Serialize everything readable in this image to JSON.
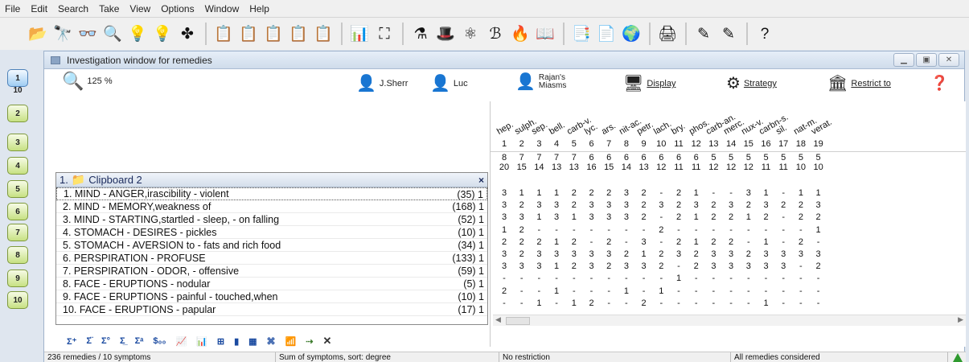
{
  "menubar": [
    "File",
    "Edit",
    "Search",
    "Take",
    "View",
    "Options",
    "Window",
    "Help"
  ],
  "toolbar_icons": [
    "open-icon",
    "binoculars-icon",
    "glasses-icon",
    "magnify-icon",
    "lightbulb-icon",
    "lightbulb-plus-icon",
    "repertory-icon",
    "clipboard-icon",
    "clipboard-1-icon",
    "clipboard-2-icon",
    "clipboard-3-icon",
    "clipboard-4-icon",
    "chart-icon",
    "hierarchy-icon",
    "flask-icon",
    "hat-icon",
    "orbit-icon",
    "ms-icon",
    "flame-icon",
    "book-icon",
    "compare-icon",
    "report-icon",
    "globe-icon",
    "printer-icon",
    "pencil-icon",
    "pencil2-icon",
    "help-icon"
  ],
  "left_tabs": [
    "1",
    "10",
    "2",
    "3",
    "4",
    "5",
    "6",
    "7",
    "8",
    "9",
    "10"
  ],
  "window": {
    "title": "Investigation window for remedies",
    "zoom": "125 %",
    "btn_sherr": "J.Sherr",
    "btn_luc": "Luc",
    "btn_rajan": "Rajan's Miasms",
    "btn_display": "Display",
    "btn_strategy": "Strategy",
    "btn_restrict": "Restrict to"
  },
  "clipboard": {
    "header": "1.",
    "name": "Clipboard 2",
    "close": "×"
  },
  "symptoms": [
    {
      "label": "1. MIND - ANGER,irascibility - violent",
      "count": "(35) 1"
    },
    {
      "label": "2. MIND - MEMORY,weakness of",
      "count": "(168) 1"
    },
    {
      "label": "3. MIND - STARTING,startled - sleep, - on falling",
      "count": "(52) 1"
    },
    {
      "label": "4. STOMACH - DESIRES - pickles",
      "count": "(10) 1"
    },
    {
      "label": "5. STOMACH - AVERSION to - fats and rich food",
      "count": "(34) 1"
    },
    {
      "label": "6. PERSPIRATION - PROFUSE",
      "count": "(133) 1"
    },
    {
      "label": "7. PERSPIRATION - ODOR, - offensive",
      "count": "(59) 1"
    },
    {
      "label": "8. FACE - ERUPTIONS - nodular",
      "count": "(5) 1"
    },
    {
      "label": "9. FACE - ERUPTIONS - painful - touched,when",
      "count": "(10) 1"
    },
    {
      "label": "10. FACE - ERUPTIONS - papular",
      "count": "(17) 1"
    }
  ],
  "remedies": [
    "hep.",
    "sulph.",
    "sep.",
    "bell.",
    "carb-v.",
    "lyc.",
    "ars.",
    "nit-ac.",
    "petr.",
    "lach.",
    "bry.",
    "phos.",
    "carb-an.",
    "merc.",
    "nux-v.",
    "carbn-s.",
    "sil.",
    "nat-m.",
    "verat."
  ],
  "rank": [
    "1",
    "2",
    "3",
    "4",
    "5",
    "6",
    "7",
    "8",
    "9",
    "10",
    "11",
    "12",
    "13",
    "14",
    "15",
    "16",
    "17",
    "18",
    "19"
  ],
  "counts": [
    "8",
    "7",
    "7",
    "7",
    "7",
    "6",
    "6",
    "6",
    "6",
    "6",
    "6",
    "6",
    "5",
    "5",
    "5",
    "5",
    "5",
    "5",
    "5"
  ],
  "sums": [
    "20",
    "15",
    "14",
    "13",
    "13",
    "16",
    "15",
    "14",
    "13",
    "12",
    "11",
    "11",
    "12",
    "12",
    "12",
    "11",
    "11",
    "10",
    "10"
  ],
  "grades": [
    [
      "3",
      "1",
      "1",
      "1",
      "2",
      "2",
      "2",
      "3",
      "2",
      "-",
      "2",
      "1",
      "-",
      "-",
      "3",
      "1",
      "-",
      "1",
      "1"
    ],
    [
      "3",
      "2",
      "3",
      "3",
      "2",
      "3",
      "3",
      "3",
      "2",
      "3",
      "2",
      "3",
      "2",
      "3",
      "2",
      "3",
      "2",
      "2",
      "3"
    ],
    [
      "3",
      "3",
      "1",
      "3",
      "1",
      "3",
      "3",
      "3",
      "2",
      "-",
      "2",
      "1",
      "2",
      "2",
      "1",
      "2",
      "-",
      "2",
      "2"
    ],
    [
      "1",
      "2",
      "-",
      "-",
      "-",
      "-",
      "-",
      "-",
      "-",
      "2",
      "-",
      "-",
      "-",
      "-",
      "-",
      "-",
      "-",
      "-",
      "1"
    ],
    [
      "2",
      "2",
      "2",
      "1",
      "2",
      "-",
      "2",
      "-",
      "3",
      "-",
      "2",
      "1",
      "2",
      "2",
      "-",
      "1",
      "-",
      "2",
      "-"
    ],
    [
      "3",
      "2",
      "3",
      "3",
      "3",
      "3",
      "3",
      "2",
      "1",
      "2",
      "3",
      "2",
      "3",
      "3",
      "2",
      "3",
      "3",
      "3",
      "3"
    ],
    [
      "3",
      "3",
      "3",
      "1",
      "2",
      "3",
      "2",
      "3",
      "3",
      "2",
      "-",
      "2",
      "3",
      "3",
      "3",
      "3",
      "3",
      "-",
      "2"
    ],
    [
      "-",
      "-",
      "-",
      "-",
      "-",
      "-",
      "-",
      "-",
      "-",
      "-",
      "1",
      "-",
      "-",
      "-",
      "-",
      "-",
      "-",
      "-",
      "-"
    ],
    [
      "2",
      "-",
      "-",
      "1",
      "-",
      "-",
      "-",
      "1",
      "-",
      "1",
      "-",
      "-",
      "-",
      "-",
      "-",
      "-",
      "-",
      "-",
      "-"
    ],
    [
      "-",
      "-",
      "1",
      "-",
      "1",
      "2",
      "-",
      "-",
      "2",
      "-",
      "-",
      "-",
      "-",
      "-",
      "-",
      "1",
      "-",
      "-",
      "-"
    ]
  ],
  "bottom_icons": [
    "Σ⁺",
    "Σ̈",
    "Σ°",
    "Σ̲",
    "Σᵃ",
    "$",
    "chart",
    "chart2",
    "grid",
    "bar",
    "grid2",
    "tree",
    "chart3",
    "arrow"
  ],
  "status": {
    "remedies": "236 remedies / 10 symptoms",
    "sort": "Sum of symptoms, sort: degree",
    "restriction": "No restriction",
    "considered": "All remedies considered"
  },
  "colors": {
    "accent": "#1a2a5c",
    "tab_green": "#c7e183",
    "window_bg": "#dfe6ef"
  }
}
